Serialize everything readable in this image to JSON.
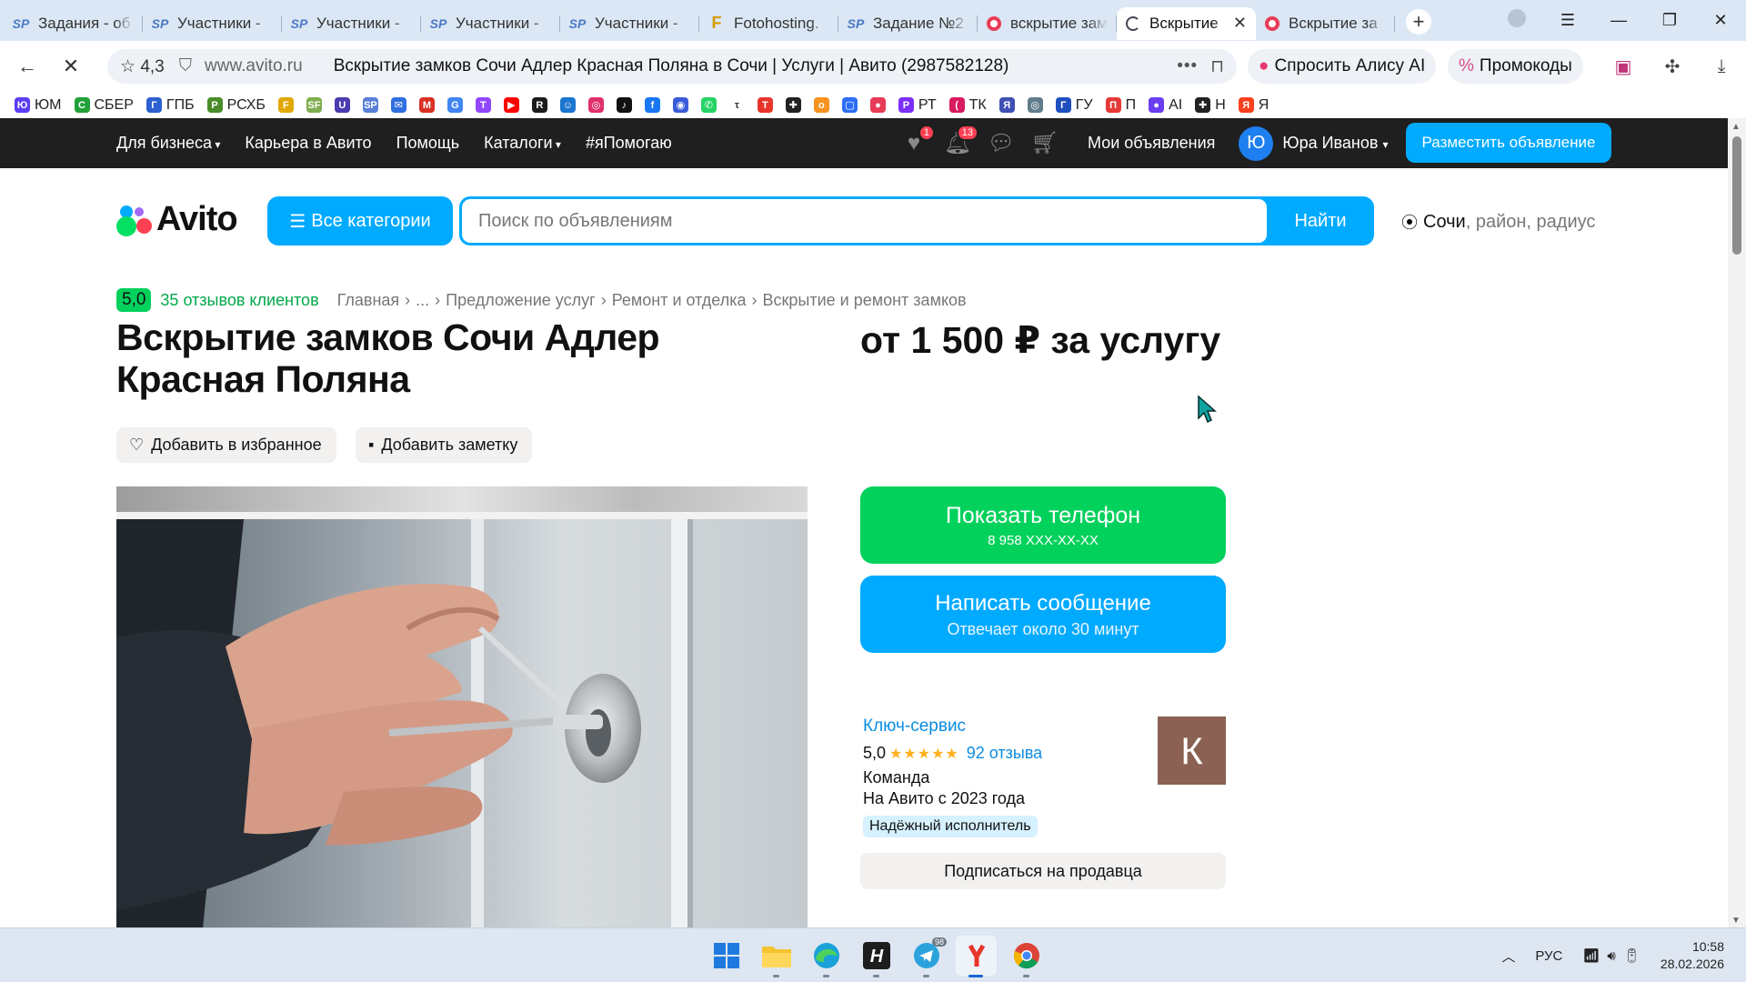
{
  "browser": {
    "tabs": [
      {
        "fav": "sp",
        "label": "Задания - об"
      },
      {
        "fav": "sp",
        "label": "Участники - "
      },
      {
        "fav": "sp",
        "label": "Участники - "
      },
      {
        "fav": "sp",
        "label": "Участники - "
      },
      {
        "fav": "sp",
        "label": "Участники - "
      },
      {
        "fav": "ff",
        "label": "Fotohosting."
      },
      {
        "fav": "sp",
        "label": "Задание №2"
      },
      {
        "fav": "av",
        "label": "вскрытие зам"
      },
      {
        "fav": "spin",
        "label": "Вскрытие"
      },
      {
        "fav": "av",
        "label": "Вскрытие за"
      }
    ],
    "active_tab_index": 8,
    "address": {
      "rating": "4,3",
      "domain": "www.avito.ru",
      "page_title": "Вскрытие замков Сочи Адлер Красная Поляна в Сочи | Услуги | Авито (2987582128)"
    },
    "alice_label": "Спросить Алису AI",
    "promo_label": "Промокоды",
    "bookmarks": [
      {
        "label": "ЮМ",
        "color": "#5b3df5",
        "glyph": "Ю"
      },
      {
        "label": "СБЕР",
        "color": "#21a038",
        "glyph": "С"
      },
      {
        "label": "ГПБ",
        "color": "#2c5fcf",
        "glyph": "Г"
      },
      {
        "label": "РСХБ",
        "color": "#4a8c2a",
        "glyph": "Р"
      },
      {
        "label": "",
        "color": "#e0a800",
        "glyph": "F"
      },
      {
        "label": "",
        "color": "#7fae4e",
        "glyph": "SF"
      },
      {
        "label": "",
        "color": "#4b3bb0",
        "glyph": "U"
      },
      {
        "label": "",
        "color": "#5a7fd6",
        "glyph": "SP"
      },
      {
        "label": "",
        "color": "#2f6fe0",
        "glyph": "✉"
      },
      {
        "label": "",
        "color": "#d93025",
        "glyph": "M"
      },
      {
        "label": "",
        "color": "#4285f4",
        "glyph": "G"
      },
      {
        "label": "",
        "color": "#9146ff",
        "glyph": "T"
      },
      {
        "label": "",
        "color": "#ff0000",
        "glyph": "▶"
      },
      {
        "label": "",
        "color": "#1b1b1b",
        "glyph": "R"
      },
      {
        "label": "",
        "color": "#1b75d0",
        "glyph": "☺"
      },
      {
        "label": "",
        "color": "#e1306c",
        "glyph": "◎"
      },
      {
        "label": "",
        "color": "#111111",
        "glyph": "♪"
      },
      {
        "label": "",
        "color": "#1877f2",
        "glyph": "f"
      },
      {
        "label": "",
        "color": "#3a5bd9",
        "glyph": "◉"
      },
      {
        "label": "",
        "color": "#25d366",
        "glyph": "✆"
      },
      {
        "label": "",
        "color": "#ffffff",
        "glyph": "τ"
      },
      {
        "label": "",
        "color": "#e8352b",
        "glyph": "T"
      },
      {
        "label": "",
        "color": "#222222",
        "glyph": "✚"
      },
      {
        "label": "",
        "color": "#f7931e",
        "glyph": "о"
      },
      {
        "label": "",
        "color": "#2d6df6",
        "glyph": "▢"
      },
      {
        "label": "",
        "color": "#e83b56",
        "glyph": "●"
      },
      {
        "label": "РТ",
        "color": "#7b2ff7",
        "glyph": "Р"
      },
      {
        "label": "ТК",
        "color": "#d81b60",
        "glyph": "("
      },
      {
        "label": "",
        "color": "#3f51b5",
        "glyph": "Я"
      },
      {
        "label": "",
        "color": "#607d8b",
        "glyph": "◎"
      },
      {
        "label": "ГУ",
        "color": "#1f4fbf",
        "glyph": "Г"
      },
      {
        "label": "П",
        "color": "#e53935",
        "glyph": "П"
      },
      {
        "label": "AI",
        "color": "#6a3df0",
        "glyph": "●"
      },
      {
        "label": "Н",
        "color": "#222222",
        "glyph": "✚"
      },
      {
        "label": "Я",
        "color": "#fc3f1d",
        "glyph": "Я"
      }
    ]
  },
  "header": {
    "links": [
      "Для бизнеса",
      "Карьера в Авито",
      "Помощь",
      "Каталоги",
      "#яПомогаю"
    ],
    "fav_badge": "1",
    "notif_badge": "13",
    "my_ads": "Мои объявления",
    "avatar_letter": "Ю",
    "user_name": "Юра Иванов",
    "post_button": "Разместить объявление"
  },
  "search": {
    "logo_text": "Avito",
    "all_categories": "Все категории",
    "placeholder": "Поиск по объявлениям",
    "find_button": "Найти",
    "city": "Сочи",
    "location_rest": ", район, радиус"
  },
  "listing": {
    "score": "5,0",
    "reviews_link": "35 отзывов клиентов",
    "breadcrumbs": [
      "Главная",
      "...",
      "Предложение услуг",
      "Ремонт и отделка",
      "Вскрытие и ремонт замков"
    ],
    "title": "Вскрытие замков Сочи Адлер Красная Поляна",
    "price": "от 1 500 ₽ за услугу",
    "add_favorite": "Добавить в избранное",
    "add_note": "Добавить заметку",
    "phone_button": "Показать телефон",
    "phone_masked": "8 958 XXX-XX-XX",
    "message_button": "Написать сообщение",
    "response_time": "Отвечает около 30 минут",
    "seller": {
      "name": "Ключ-сервис",
      "rating": "5,0",
      "stars": "★★★★★",
      "reviews": "92 отзыва",
      "type": "Команда",
      "since": "На Авито с 2023 года",
      "badge": "Надёжный исполнитель",
      "avatar_letter": "К"
    },
    "subscribe": "Подписаться на продавца"
  },
  "taskbar": {
    "telegram_badge": "98",
    "lang": "РУС",
    "time": "10:58",
    "date": "28.02.2026"
  }
}
